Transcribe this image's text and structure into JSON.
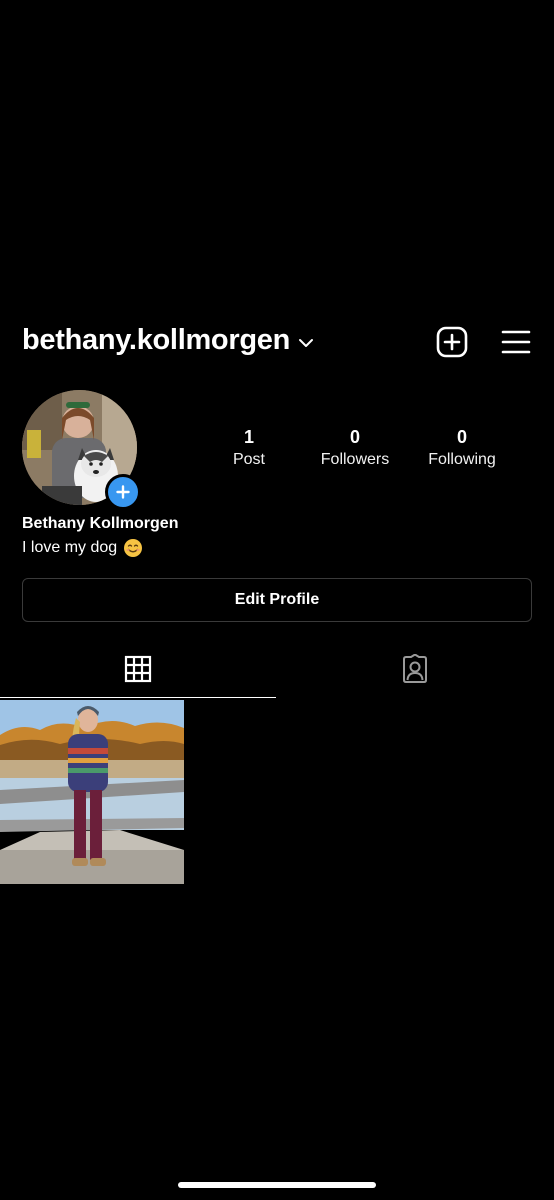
{
  "header": {
    "username": "bethany.kollmorgen",
    "icons": {
      "chevron": "chevron-down-icon",
      "new_post": "add-square-icon",
      "menu": "hamburger-menu-icon"
    }
  },
  "profile": {
    "full_name": "Bethany Kollmorgen",
    "bio": "I love my dog",
    "bio_emoji": "smiling-face-emoji",
    "avatar": "profile-photo-woman-with-husky",
    "add_story_icon": "plus-icon"
  },
  "stats": {
    "posts": {
      "value": "1",
      "label": "Post"
    },
    "followers": {
      "value": "0",
      "label": "Followers"
    },
    "following": {
      "value": "0",
      "label": "Following"
    }
  },
  "actions": {
    "edit_profile": "Edit Profile"
  },
  "tabs": [
    {
      "icon": "grid-icon",
      "active": true
    },
    {
      "icon": "tagged-person-icon",
      "active": false
    }
  ],
  "posts": [
    {
      "thumbnail": "woman-on-dock-by-lake-autumn"
    }
  ],
  "colors": {
    "background": "#000000",
    "text": "#ffffff",
    "accent": "#3897f0",
    "border": "#3a3a3a"
  }
}
